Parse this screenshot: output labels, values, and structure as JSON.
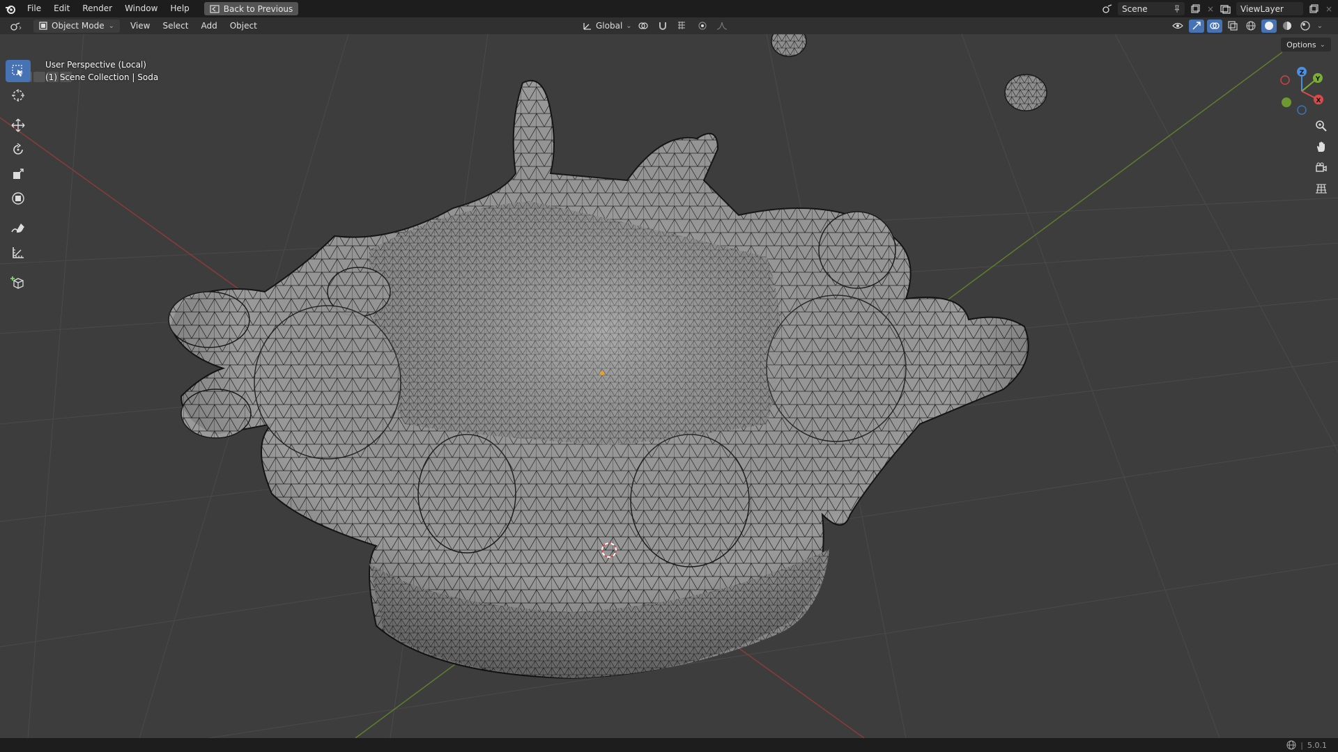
{
  "topbar": {
    "menus": [
      "File",
      "Edit",
      "Render",
      "Window",
      "Help"
    ],
    "back_label": "Back to Previous",
    "scene_label": "Scene",
    "viewlayer_label": "ViewLayer"
  },
  "header": {
    "mode_label": "Object Mode",
    "menus": [
      "View",
      "Select",
      "Add",
      "Object"
    ],
    "orientation_label": "Global"
  },
  "viewport": {
    "perspective_label": "User Perspective (Local)",
    "collection_label": "(1) Scene Collection | Soda",
    "options_label": "Options",
    "gizmo": {
      "z": "Z",
      "y": "Y",
      "x": "X"
    }
  },
  "status": {
    "version": "5.0.1"
  },
  "colors": {
    "accent": "#4772b3",
    "x_axis": "#d94b4b",
    "y_axis": "#7cae37",
    "z_axis": "#4a8fe0"
  }
}
